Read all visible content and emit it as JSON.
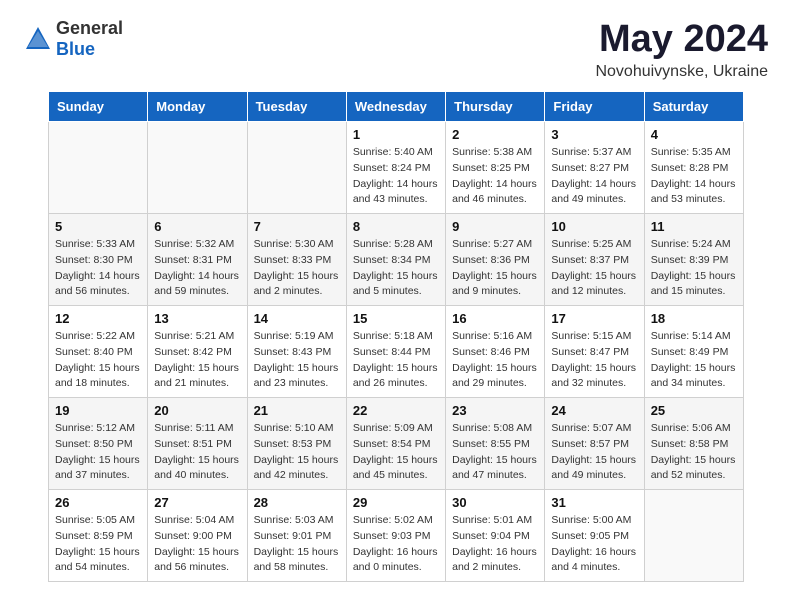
{
  "header": {
    "logo_general": "General",
    "logo_blue": "Blue",
    "month_title": "May 2024",
    "location": "Novohuivynske, Ukraine"
  },
  "days_of_week": [
    "Sunday",
    "Monday",
    "Tuesday",
    "Wednesday",
    "Thursday",
    "Friday",
    "Saturday"
  ],
  "weeks": [
    {
      "alt": false,
      "days": [
        {
          "num": "",
          "info": ""
        },
        {
          "num": "",
          "info": ""
        },
        {
          "num": "",
          "info": ""
        },
        {
          "num": "1",
          "info": "Sunrise: 5:40 AM\nSunset: 8:24 PM\nDaylight: 14 hours\nand 43 minutes."
        },
        {
          "num": "2",
          "info": "Sunrise: 5:38 AM\nSunset: 8:25 PM\nDaylight: 14 hours\nand 46 minutes."
        },
        {
          "num": "3",
          "info": "Sunrise: 5:37 AM\nSunset: 8:27 PM\nDaylight: 14 hours\nand 49 minutes."
        },
        {
          "num": "4",
          "info": "Sunrise: 5:35 AM\nSunset: 8:28 PM\nDaylight: 14 hours\nand 53 minutes."
        }
      ]
    },
    {
      "alt": true,
      "days": [
        {
          "num": "5",
          "info": "Sunrise: 5:33 AM\nSunset: 8:30 PM\nDaylight: 14 hours\nand 56 minutes."
        },
        {
          "num": "6",
          "info": "Sunrise: 5:32 AM\nSunset: 8:31 PM\nDaylight: 14 hours\nand 59 minutes."
        },
        {
          "num": "7",
          "info": "Sunrise: 5:30 AM\nSunset: 8:33 PM\nDaylight: 15 hours\nand 2 minutes."
        },
        {
          "num": "8",
          "info": "Sunrise: 5:28 AM\nSunset: 8:34 PM\nDaylight: 15 hours\nand 5 minutes."
        },
        {
          "num": "9",
          "info": "Sunrise: 5:27 AM\nSunset: 8:36 PM\nDaylight: 15 hours\nand 9 minutes."
        },
        {
          "num": "10",
          "info": "Sunrise: 5:25 AM\nSunset: 8:37 PM\nDaylight: 15 hours\nand 12 minutes."
        },
        {
          "num": "11",
          "info": "Sunrise: 5:24 AM\nSunset: 8:39 PM\nDaylight: 15 hours\nand 15 minutes."
        }
      ]
    },
    {
      "alt": false,
      "days": [
        {
          "num": "12",
          "info": "Sunrise: 5:22 AM\nSunset: 8:40 PM\nDaylight: 15 hours\nand 18 minutes."
        },
        {
          "num": "13",
          "info": "Sunrise: 5:21 AM\nSunset: 8:42 PM\nDaylight: 15 hours\nand 21 minutes."
        },
        {
          "num": "14",
          "info": "Sunrise: 5:19 AM\nSunset: 8:43 PM\nDaylight: 15 hours\nand 23 minutes."
        },
        {
          "num": "15",
          "info": "Sunrise: 5:18 AM\nSunset: 8:44 PM\nDaylight: 15 hours\nand 26 minutes."
        },
        {
          "num": "16",
          "info": "Sunrise: 5:16 AM\nSunset: 8:46 PM\nDaylight: 15 hours\nand 29 minutes."
        },
        {
          "num": "17",
          "info": "Sunrise: 5:15 AM\nSunset: 8:47 PM\nDaylight: 15 hours\nand 32 minutes."
        },
        {
          "num": "18",
          "info": "Sunrise: 5:14 AM\nSunset: 8:49 PM\nDaylight: 15 hours\nand 34 minutes."
        }
      ]
    },
    {
      "alt": true,
      "days": [
        {
          "num": "19",
          "info": "Sunrise: 5:12 AM\nSunset: 8:50 PM\nDaylight: 15 hours\nand 37 minutes."
        },
        {
          "num": "20",
          "info": "Sunrise: 5:11 AM\nSunset: 8:51 PM\nDaylight: 15 hours\nand 40 minutes."
        },
        {
          "num": "21",
          "info": "Sunrise: 5:10 AM\nSunset: 8:53 PM\nDaylight: 15 hours\nand 42 minutes."
        },
        {
          "num": "22",
          "info": "Sunrise: 5:09 AM\nSunset: 8:54 PM\nDaylight: 15 hours\nand 45 minutes."
        },
        {
          "num": "23",
          "info": "Sunrise: 5:08 AM\nSunset: 8:55 PM\nDaylight: 15 hours\nand 47 minutes."
        },
        {
          "num": "24",
          "info": "Sunrise: 5:07 AM\nSunset: 8:57 PM\nDaylight: 15 hours\nand 49 minutes."
        },
        {
          "num": "25",
          "info": "Sunrise: 5:06 AM\nSunset: 8:58 PM\nDaylight: 15 hours\nand 52 minutes."
        }
      ]
    },
    {
      "alt": false,
      "days": [
        {
          "num": "26",
          "info": "Sunrise: 5:05 AM\nSunset: 8:59 PM\nDaylight: 15 hours\nand 54 minutes."
        },
        {
          "num": "27",
          "info": "Sunrise: 5:04 AM\nSunset: 9:00 PM\nDaylight: 15 hours\nand 56 minutes."
        },
        {
          "num": "28",
          "info": "Sunrise: 5:03 AM\nSunset: 9:01 PM\nDaylight: 15 hours\nand 58 minutes."
        },
        {
          "num": "29",
          "info": "Sunrise: 5:02 AM\nSunset: 9:03 PM\nDaylight: 16 hours\nand 0 minutes."
        },
        {
          "num": "30",
          "info": "Sunrise: 5:01 AM\nSunset: 9:04 PM\nDaylight: 16 hours\nand 2 minutes."
        },
        {
          "num": "31",
          "info": "Sunrise: 5:00 AM\nSunset: 9:05 PM\nDaylight: 16 hours\nand 4 minutes."
        },
        {
          "num": "",
          "info": ""
        }
      ]
    }
  ]
}
